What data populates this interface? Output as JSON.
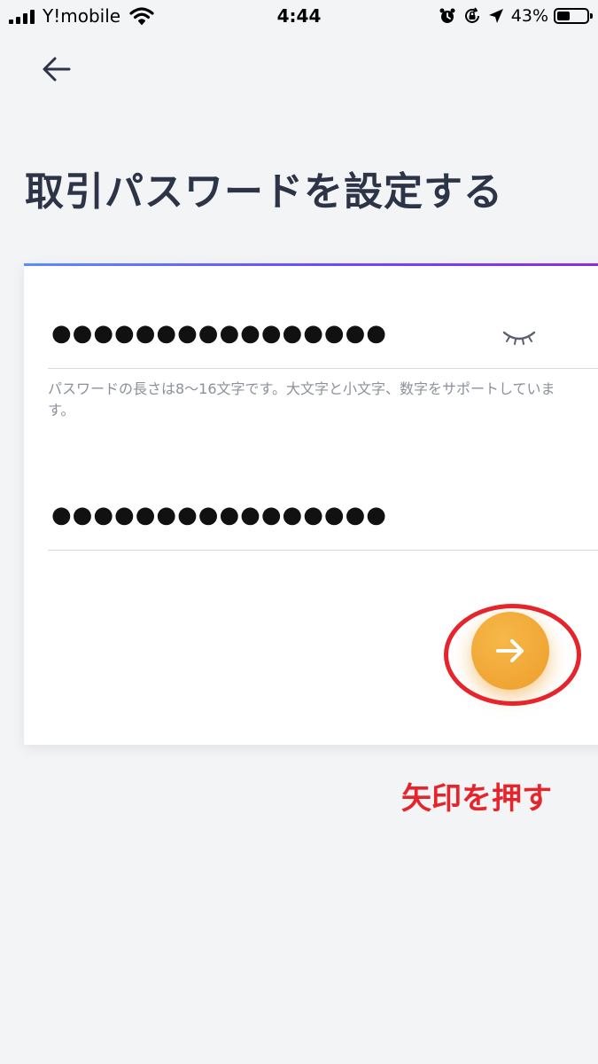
{
  "status_bar": {
    "carrier": "Y!mobile",
    "time": "4:44",
    "battery_percent": "43%",
    "battery_level": 0.43
  },
  "header": {
    "title": "取引パスワードを設定する"
  },
  "form": {
    "password_value": "●●●●●●●●●●●●●●●●",
    "confirm_value": "●●●●●●●●●●●●●●●●",
    "hint": "パスワードの長さは8〜16文字です。大文字と小文字、数字をサポートしています。"
  },
  "annotation": {
    "text": "矢印を押す",
    "color": "#e5242b"
  },
  "colors": {
    "accent": "#ee9d2a",
    "background": "#f3f4f6",
    "title": "#2e3447"
  },
  "icons": {
    "back": "arrow-left-icon",
    "toggle": "eye-closed-icon",
    "next": "arrow-right-icon"
  }
}
